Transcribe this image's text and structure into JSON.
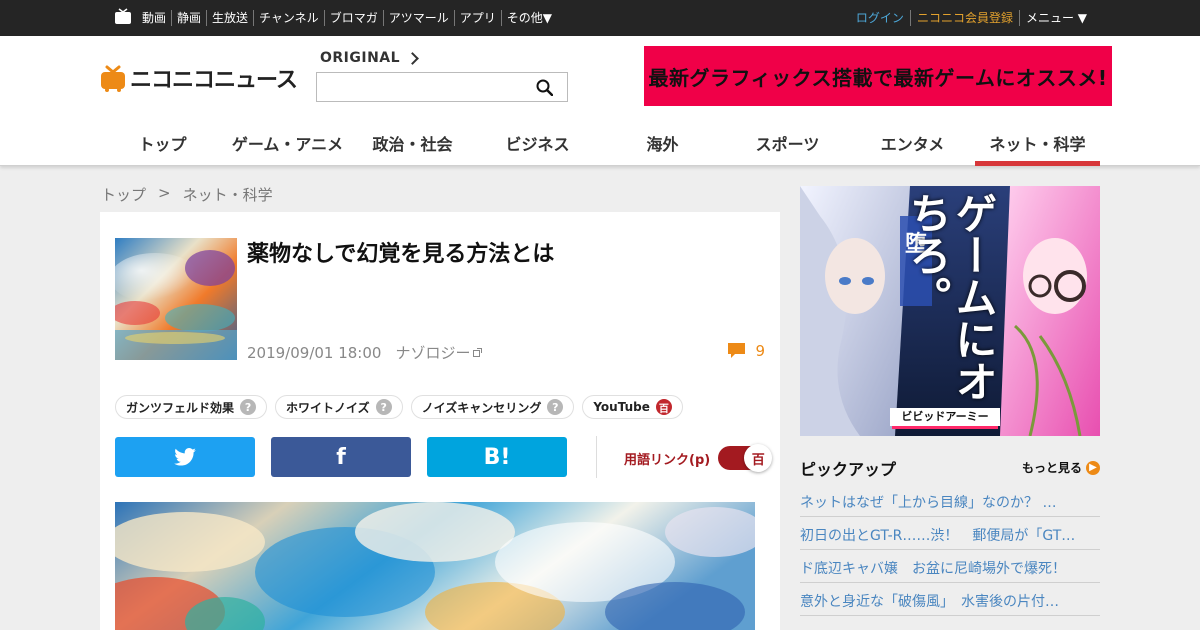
{
  "topbar": {
    "nav": [
      "動画",
      "静画",
      "生放送",
      "チャンネル",
      "ブロマガ",
      "アツマール",
      "アプリ",
      "その他▼"
    ],
    "login": "ログイン",
    "register": "ニコニコ会員登録",
    "menu": "メニュー ▼"
  },
  "header": {
    "logo_text": "ニコニコニュース",
    "original_label": "ORIGINAL",
    "search_placeholder": "",
    "ad_text": "最新グラフィックス搭載で最新ゲームにオススメ!",
    "categories": [
      "トップ",
      "ゲーム・アニメ",
      "政治・社会",
      "ビジネス",
      "海外",
      "スポーツ",
      "エンタメ",
      "ネット・科学"
    ],
    "active_category": "ネット・科学"
  },
  "breadcrumb": [
    "トップ",
    ">",
    "ネット・科学"
  ],
  "article": {
    "title": "薬物なしで幻覚を見る方法とは",
    "date": "2019/09/01 18:00",
    "source": "ナゾロジー",
    "comment_count": "9",
    "tags": [
      {
        "label": "ガンツフェルド効果",
        "icon": "?"
      },
      {
        "label": "ホワイトノイズ",
        "icon": "?"
      },
      {
        "label": "ノイズキャンセリング",
        "icon": "?"
      },
      {
        "label": "YouTube",
        "icon": "百"
      }
    ],
    "share": {
      "twitter": "twitter-icon",
      "facebook": "f",
      "hatena": "B!"
    },
    "term_link_label": "用語リンク(p)",
    "term_link_icon": "百"
  },
  "sidebar": {
    "ad_title": "ゲームにオちろ。",
    "ad_badge": "堕",
    "ad_logo": "ビビッドアーミー",
    "pickup_title": "ピックアップ",
    "more_label": "もっと見る",
    "pickups": [
      "ネットはなぜ「上から目線」なのか？ …",
      "初日の出とGT-R……渋！　郵便局が「GT…",
      "ド底辺キャバ嬢　お盆に尼崎場外で爆死！",
      "意外と身近な「破傷風」　水害後の片付…"
    ]
  }
}
